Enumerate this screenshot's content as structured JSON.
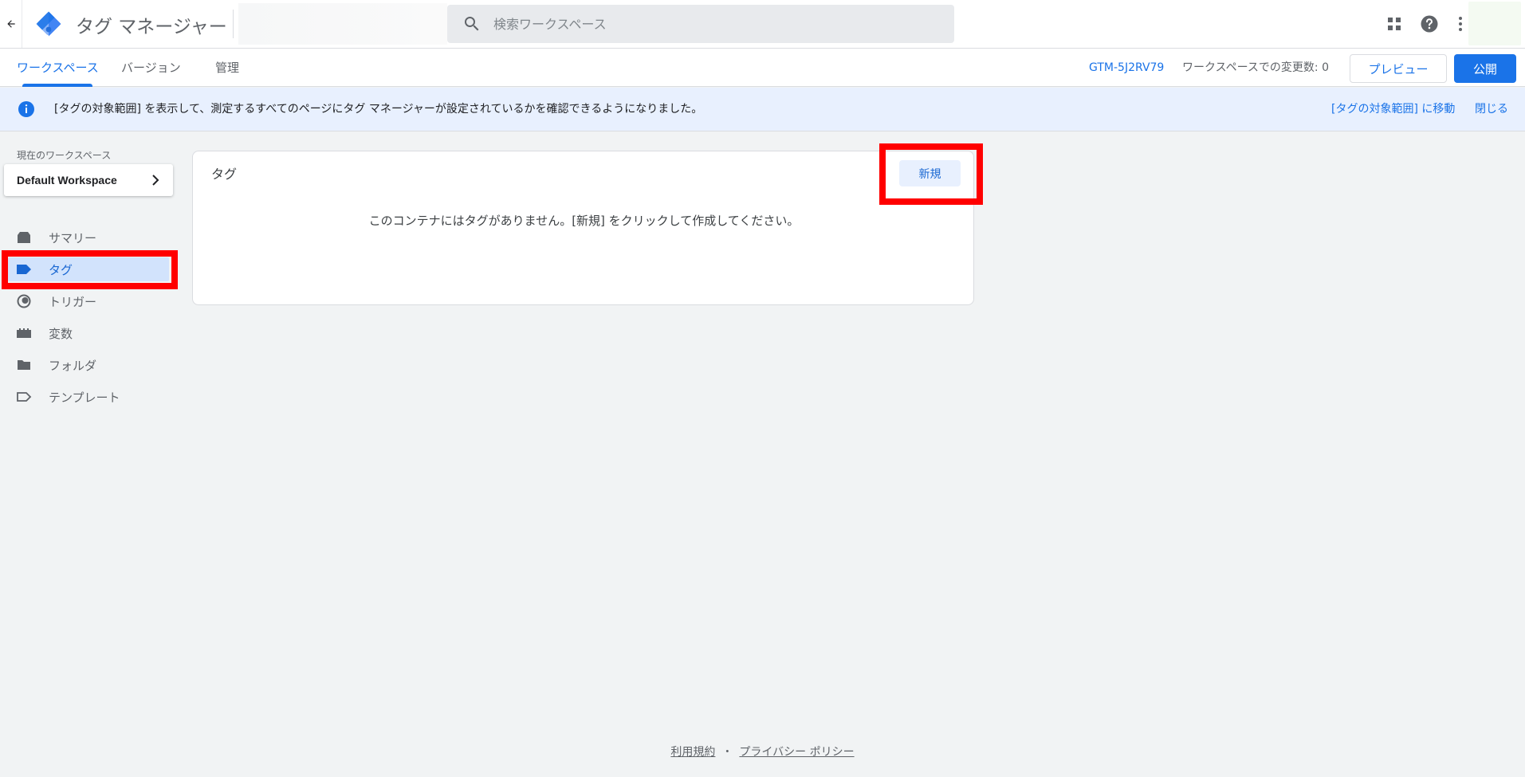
{
  "topbar": {
    "back_icon": "arrow-back-icon",
    "logo_icon": "tag-manager-logo",
    "app_title": "タグ マネージャー",
    "search_placeholder": "検索ワークスペース",
    "apps_icon": "apps-grid-icon",
    "help_icon": "help-icon",
    "more_icon": "more-vert-icon"
  },
  "subnav": {
    "tabs": [
      {
        "label": "ワークスペース",
        "active": true
      },
      {
        "label": "バージョン",
        "active": false
      },
      {
        "label": "管理",
        "active": false
      }
    ],
    "container_id": "GTM-5J2RV79",
    "changes_text": "ワークスペースでの変更数: 0",
    "preview_label": "プレビュー",
    "publish_label": "公開"
  },
  "banner": {
    "icon": "info-icon",
    "text": "[タグの対象範囲] を表示して、測定するすべてのページにタグ マネージャーが設定されているかを確認できるようになりました。",
    "link_label": "[タグの対象範囲] に移動",
    "close_label": "閉じる"
  },
  "sidebar": {
    "workspace_label": "現在のワークスペース",
    "workspace_name": "Default Workspace",
    "items": [
      {
        "label": "サマリー",
        "icon": "summary-icon",
        "active": false
      },
      {
        "label": "タグ",
        "icon": "tag-icon",
        "active": true
      },
      {
        "label": "トリガー",
        "icon": "trigger-icon",
        "active": false
      },
      {
        "label": "変数",
        "icon": "variables-icon",
        "active": false
      },
      {
        "label": "フォルダ",
        "icon": "folder-icon",
        "active": false
      },
      {
        "label": "テンプレート",
        "icon": "template-icon",
        "active": false
      }
    ]
  },
  "main": {
    "card_title": "タグ",
    "new_button": "新規",
    "empty_message": "このコンテナにはタグがありません。[新規] をクリックして作成してください。"
  },
  "footer": {
    "terms": "利用規約",
    "separator": "・",
    "privacy": "プライバシー ポリシー"
  },
  "colors": {
    "accent": "#1a73e8",
    "highlight": "#ff0000",
    "banner_bg": "#e8f0fe",
    "active_nav_bg": "#d2e3fc"
  }
}
